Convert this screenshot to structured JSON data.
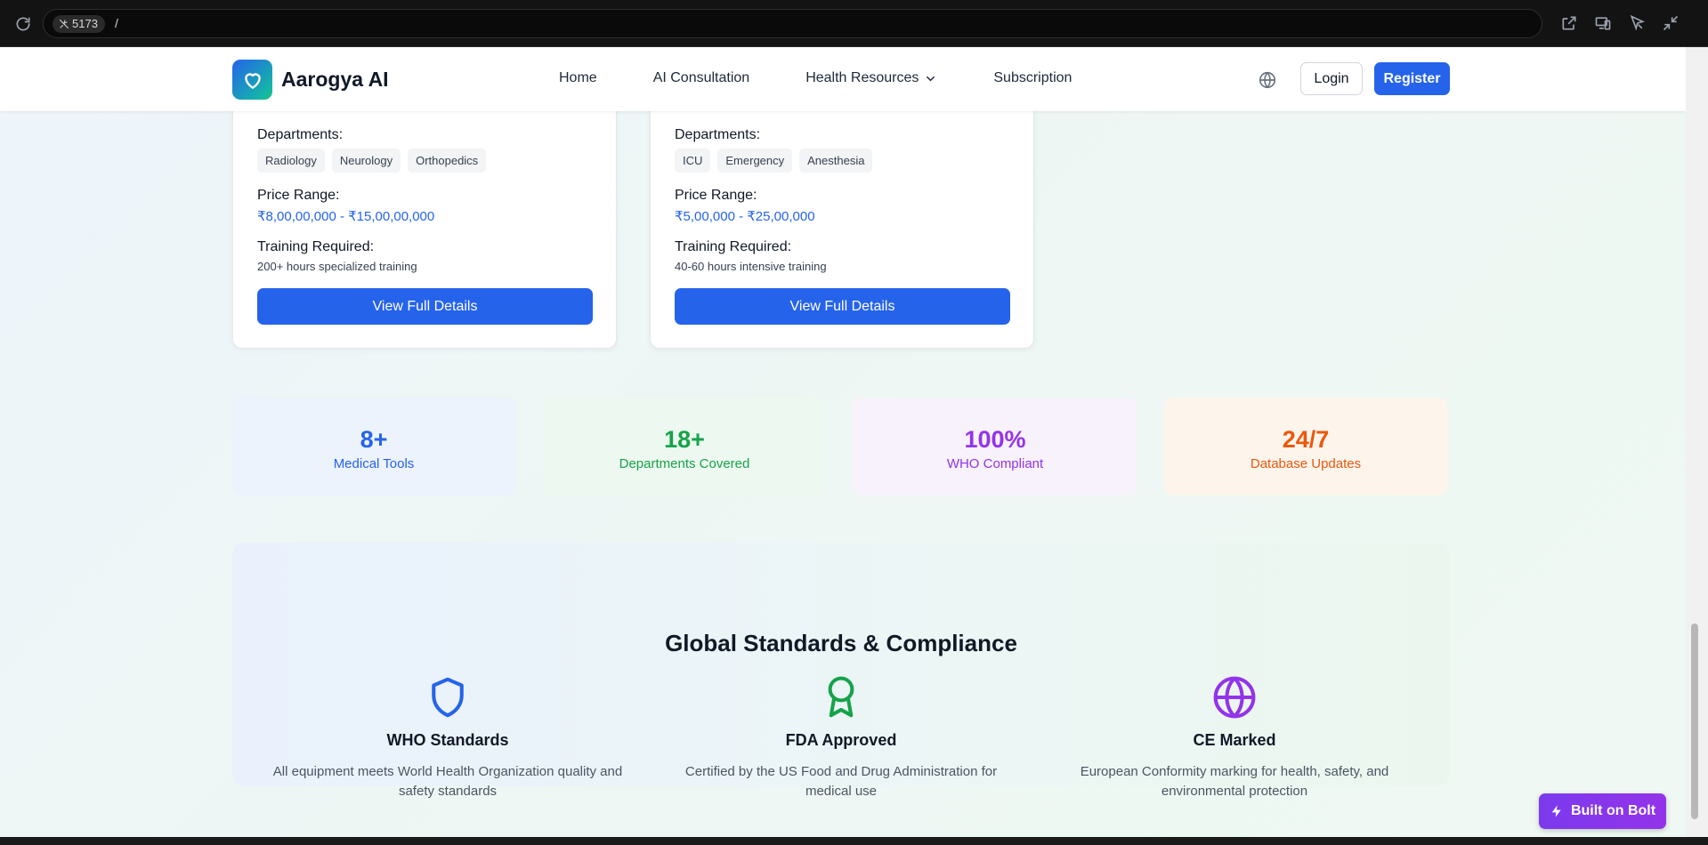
{
  "browser": {
    "port": "5173",
    "path": "/"
  },
  "header": {
    "brand": "Aarogya AI",
    "nav": [
      {
        "label": "Home"
      },
      {
        "label": "AI Consultation"
      },
      {
        "label": "Health Resources"
      },
      {
        "label": "Subscription"
      }
    ],
    "login_label": "Login",
    "register_label": "Register"
  },
  "cards": [
    {
      "departments_label": "Departments:",
      "departments": [
        "Radiology",
        "Neurology",
        "Orthopedics"
      ],
      "price_label": "Price Range:",
      "price": "₹8,00,00,000 - ₹15,00,00,000",
      "training_label": "Training Required:",
      "training": "200+ hours specialized training",
      "button_label": "View Full Details"
    },
    {
      "departments_label": "Departments:",
      "departments": [
        "ICU",
        "Emergency",
        "Anesthesia"
      ],
      "price_label": "Price Range:",
      "price": "₹5,00,000 - ₹25,00,000",
      "training_label": "Training Required:",
      "training": "40-60 hours intensive training",
      "button_label": "View Full Details"
    }
  ],
  "stats": [
    {
      "value": "8+",
      "caption": "Medical Tools",
      "color": "#2563eb"
    },
    {
      "value": "18+",
      "caption": "Departments Covered",
      "color": "#16a34a"
    },
    {
      "value": "100%",
      "caption": "WHO Compliant",
      "color": "#9333ea"
    },
    {
      "value": "24/7",
      "caption": "Database Updates",
      "color": "#ea580c"
    }
  ],
  "compliance": {
    "title": "Global Standards & Compliance",
    "items": [
      {
        "icon": "shield-icon",
        "heading": "WHO Standards",
        "text": "All equipment meets World Health Organization quality and safety standards",
        "color": "#2563eb"
      },
      {
        "icon": "award-icon",
        "heading": "FDA Approved",
        "text": "Certified by the US Food and Drug Administration for medical use",
        "color": "#16a34a"
      },
      {
        "icon": "globe-icon",
        "heading": "CE Marked",
        "text": "European Conformity marking for health, safety, and environmental protection",
        "color": "#9333ea"
      }
    ]
  },
  "badge": {
    "label": "Built on Bolt",
    "color": "#7c3aed"
  }
}
